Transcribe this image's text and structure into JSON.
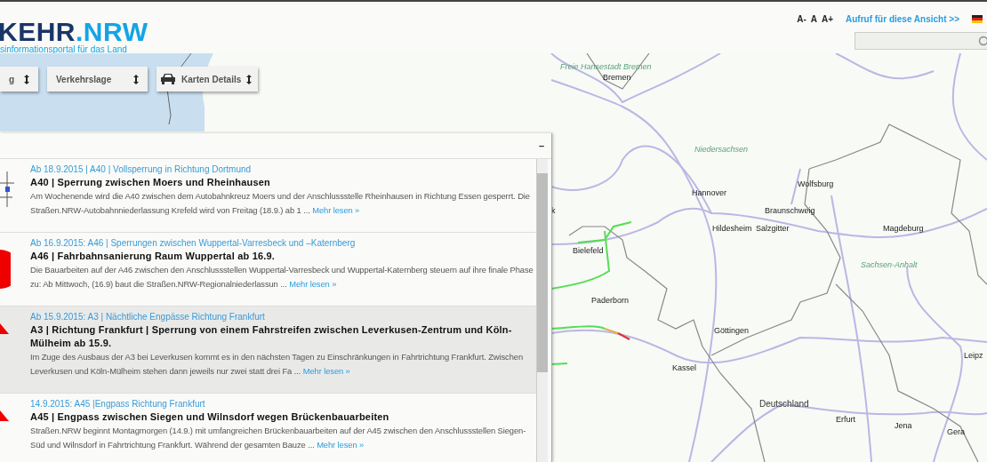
{
  "header": {
    "logo_dark": "KEHR",
    "logo_light": ".NRW",
    "tagline": "sinformationsportal für das Land",
    "font_sizes": [
      "A-",
      "A",
      "A+"
    ],
    "view_link": "Aufruf für diese Ansicht >>"
  },
  "map_buttons": [
    {
      "label": "g",
      "kind": "plain"
    },
    {
      "label": "Verkehrslage",
      "kind": "plain"
    },
    {
      "label": "Karten Details",
      "kind": "car"
    }
  ],
  "map_labels": [
    {
      "text": "Freie Hansestadt Bremen",
      "kind": "region"
    },
    {
      "text": "Bremen",
      "kind": "city"
    },
    {
      "text": "Niedersachsen",
      "kind": "region"
    },
    {
      "text": "Wolfsburg",
      "kind": "city"
    },
    {
      "text": "Hannover",
      "kind": "city"
    },
    {
      "text": "k",
      "kind": "city"
    },
    {
      "text": "Braunschweig",
      "kind": "city"
    },
    {
      "text": "Hildesheim",
      "kind": "city"
    },
    {
      "text": "Salzgitter",
      "kind": "city"
    },
    {
      "text": "Magdeburg",
      "kind": "city"
    },
    {
      "text": "Bielefeld",
      "kind": "city"
    },
    {
      "text": "Sachsen-Anhalt",
      "kind": "region"
    },
    {
      "text": "Paderborn",
      "kind": "city"
    },
    {
      "text": "Göttingen",
      "kind": "city"
    },
    {
      "text": "Leipz",
      "kind": "city"
    },
    {
      "text": "Kassel",
      "kind": "city"
    },
    {
      "text": "Deutschland",
      "kind": "country"
    },
    {
      "text": "Erfurt",
      "kind": "city"
    },
    {
      "text": "Jena",
      "kind": "city"
    },
    {
      "text": "Gera",
      "kind": "city"
    }
  ],
  "panel": {
    "minimize": "–",
    "items": [
      {
        "kind": "diagram",
        "selected": false,
        "meta": "Ab 18.9.2015 | A40 | Vollsperrung in Richtung Dortmund",
        "title": "A40 | Sperrung zwischen Moers und Rheinhausen",
        "text": "Am Wochenende wird die A40 zwischen dem Autobahnkreuz Moers und der Anschlussstelle Rheinhausen in Richtung Essen gesperrt. Die Straßen.NRW-Autobahnniederlassung Krefeld wird von Freitag (18.9.) ab 1 ...",
        "link": "Mehr lesen »"
      },
      {
        "kind": "circle",
        "selected": false,
        "meta": "Ab 16.9.2015: A46 | Sperrungen zwischen Wuppertal-Varresbeck und –Katernberg",
        "title": "A46 | Fahrbahnsanierung Raum Wuppertal ab 16.9.",
        "text": "Die Bauarbeiten auf der A46 zwischen den Anschlussstellen Wuppertal-Varresbeck und Wuppertal-Katernberg steuern auf ihre finale Phase zu: Ab Mittwoch, (16.9) baut die Straßen.NRW-Regionalniederlassun ...",
        "link": "Mehr lesen »"
      },
      {
        "kind": "triangle",
        "selected": true,
        "meta": "Ab 15.9.2015: A3 | Nächtliche Engpässe Richtung Frankfurt",
        "title": "A3 | Richtung Frankfurt | Sperrung von einem Fahrstreifen zwischen Leverkusen-Zentrum und Köln-Mülheim ab 15.9.",
        "text": "Im Zuge des Ausbaus der A3 bei Leverkusen kommt es in den nächsten Tagen zu Einschränkungen in Fahrtrichtung Frankfurt. Zwischen Leverkusen und Köln-Mülheim stehen dann jeweils nur zwei statt drei Fa ...",
        "link": "Mehr lesen »"
      },
      {
        "kind": "triangle",
        "selected": false,
        "meta": "14.9.2015: A45 |Engpass Richtung Frankfurt",
        "title": "A45 | Engpass zwischen Siegen und Wilnsdorf wegen Brückenbauarbeiten",
        "text": "Straßen.NRW beginnt Montagmorgen (14.9.) mit umfangreichen Brückenbauarbeiten auf der A45 zwischen den Anschlussstellen Siegen-Süd und Wilnsdorf in Fahrtrichtung Frankfurt. Während der gesamten Bauze ...",
        "link": "Mehr lesen »"
      }
    ]
  }
}
